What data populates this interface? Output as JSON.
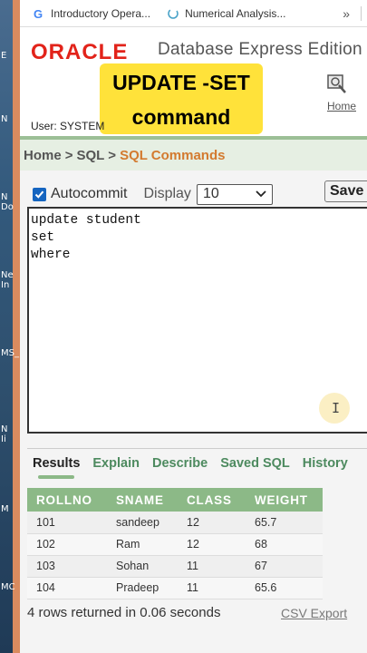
{
  "browser": {
    "bookmarks": [
      {
        "label": "Introductory Opera...",
        "icon": "google-g-icon"
      },
      {
        "label": "Numerical Analysis...",
        "icon": "loading-spinner-icon"
      }
    ],
    "more": "»"
  },
  "desktop": {
    "labels": [
      "E",
      "N",
      "N\nDo",
      "Ne\nIn",
      "MS_",
      "N\nIi",
      "M",
      "MC"
    ]
  },
  "header": {
    "logo": "ORACLE",
    "product": "Database Express Edition",
    "overlay_line1": "UPDATE -SET",
    "overlay_line2": "command",
    "user": "User: SYSTEM",
    "home_link": "Home"
  },
  "breadcrumb": {
    "items": [
      "Home",
      "SQL"
    ],
    "separator": ">",
    "active": "SQL Commands"
  },
  "toolbar": {
    "autocommit_label": "Autocommit",
    "autocommit_checked": true,
    "display_label": "Display",
    "display_value": "10",
    "save_label": "Save"
  },
  "editor": {
    "text": "update student\nset\nwhere"
  },
  "tabs": [
    "Results",
    "Explain",
    "Describe",
    "Saved SQL",
    "History"
  ],
  "results": {
    "columns": [
      "ROLLNO",
      "SNAME",
      "CLASS",
      "WEIGHT"
    ],
    "rows": [
      [
        "101",
        "sandeep",
        "12",
        "65.7"
      ],
      [
        "102",
        "Ram",
        "12",
        "68"
      ],
      [
        "103",
        "Sohan",
        "11",
        "67"
      ],
      [
        "104",
        "Pradeep",
        "11",
        "65.6"
      ]
    ],
    "footer": "4 rows returned in 0.06 seconds",
    "csv_link": "CSV Export"
  },
  "colors": {
    "oracle_red": "#e2231a",
    "overlay_yellow": "#ffe23a",
    "table_header_green": "#8cb987",
    "crumb_active": "#d37a2f"
  }
}
